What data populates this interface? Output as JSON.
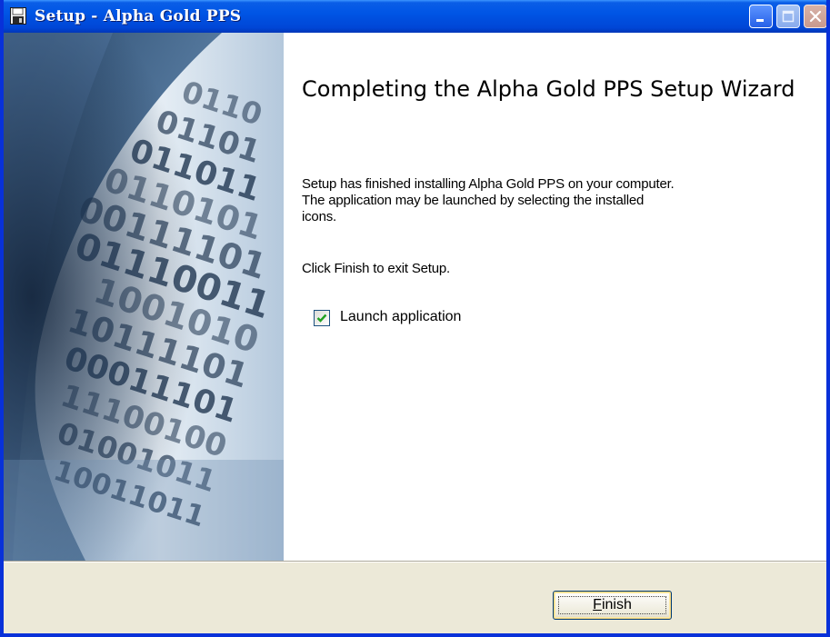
{
  "window": {
    "title": "Setup - Alpha Gold PPS",
    "icon": "floppy-disk-icon",
    "controls": [
      "minimize",
      "maximize",
      "close"
    ],
    "colors": {
      "titlebar": "#0054e3",
      "frame": "#0831d9",
      "dialog_background": "#ece9d8",
      "content_background": "#ffffff"
    }
  },
  "side_image": {
    "description_icon": "binary-digits-banner",
    "rows": [
      "0110",
      "01101",
      "011011",
      "0110101",
      "00111101",
      "01110011",
      "1001010",
      "10111101",
      "00011101",
      "11100100",
      "01001011",
      "10011011"
    ]
  },
  "main": {
    "heading": "Completing the Alpha Gold PPS Setup Wizard",
    "paragraph1_line1": "Setup has finished installing Alpha Gold PPS on your computer.",
    "paragraph1_line2": "The application may be launched by selecting the installed",
    "paragraph1_line3": "icons.",
    "paragraph2": "Click Finish to exit Setup.",
    "launch_checkbox": {
      "label": "Launch application",
      "checked": true
    }
  },
  "footer": {
    "finish_button_accesskey": "F",
    "finish_button_rest": "inish"
  }
}
